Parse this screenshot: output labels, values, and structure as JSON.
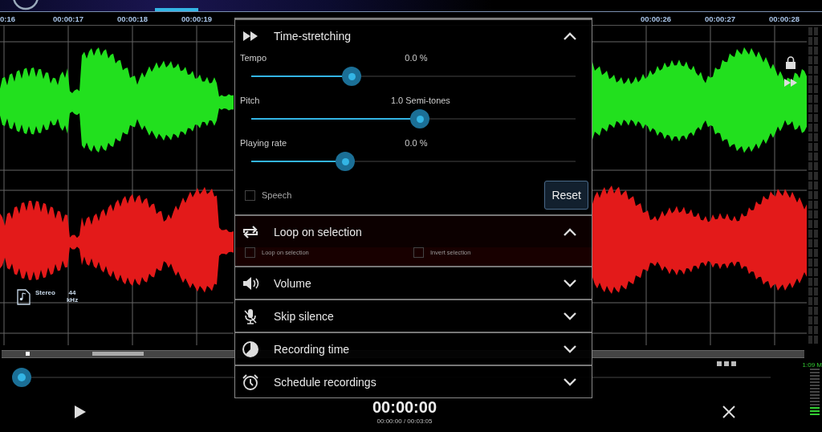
{
  "timeline": {
    "labels": [
      "0:16",
      "00:00:17",
      "00:00:18",
      "00:00:19",
      "00:00:26",
      "00:00:27",
      "00:00:28"
    ]
  },
  "file_info": {
    "channels": "Stereo",
    "rate": "44",
    "rate_unit": "kHz"
  },
  "panel": {
    "sections": [
      {
        "title": "Time-stretching",
        "expanded": true,
        "kind": "sliders",
        "sliders": [
          {
            "label": "Tempo",
            "reading": "0.0 %",
            "level": 0.31
          },
          {
            "label": "Pitch",
            "reading": "1.0 Semi-tones",
            "level": 0.52
          },
          {
            "label": "Playing rate",
            "reading": "0.0 %",
            "level": 0.29
          }
        ],
        "checkboxes": [
          {
            "label": "Speech",
            "checked": false
          }
        ],
        "button": "Reset"
      },
      {
        "title": "Loop on selection",
        "expanded": true,
        "kind": "checks",
        "checkboxes": [
          {
            "label": "Loop on selection",
            "checked": false
          },
          {
            "label": "Invert selection",
            "checked": false
          }
        ]
      },
      {
        "title": "Volume",
        "expanded": false
      },
      {
        "title": "Skip silence",
        "expanded": false
      },
      {
        "title": "Recording time",
        "expanded": false
      },
      {
        "title": "Schedule recordings",
        "expanded": false
      }
    ]
  },
  "transport": {
    "position": {
      "level": 0.0
    },
    "time": "00:00:00",
    "time_detail": "00:00:00 / 00:03:05",
    "meter_reading": "1:09 M"
  }
}
